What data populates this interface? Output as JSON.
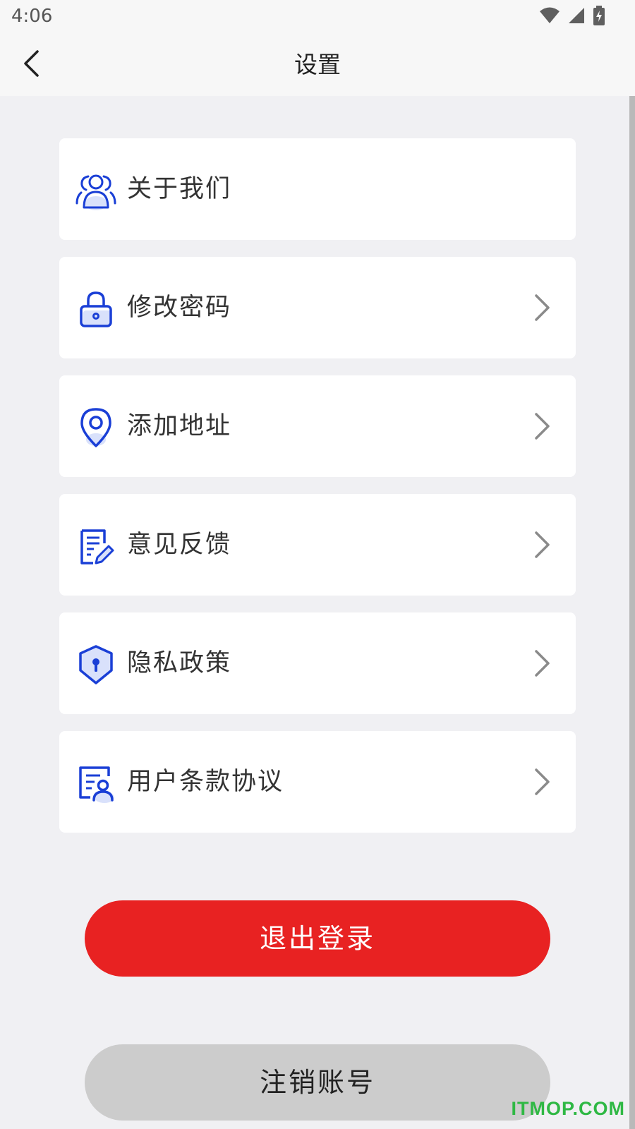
{
  "status_bar": {
    "time": "4:06",
    "icons": [
      "wifi-icon",
      "signal-icon",
      "battery-charging-icon"
    ]
  },
  "navbar": {
    "back_icon": "back-chevron-icon",
    "title": "设置"
  },
  "settings": {
    "items": [
      {
        "label": "关于我们",
        "icon": "users-icon",
        "has_chevron": false
      },
      {
        "label": "修改密码",
        "icon": "lock-icon",
        "has_chevron": true
      },
      {
        "label": "添加地址",
        "icon": "location-pin-icon",
        "has_chevron": true
      },
      {
        "label": "意见反馈",
        "icon": "feedback-edit-icon",
        "has_chevron": true
      },
      {
        "label": "隐私政策",
        "icon": "privacy-shield-icon",
        "has_chevron": true
      },
      {
        "label": "用户条款协议",
        "icon": "user-agreement-icon",
        "has_chevron": true
      }
    ]
  },
  "actions": {
    "logout_label": "退出登录",
    "cancel_account_label": "注销账号"
  },
  "watermark": "ITMOP.COM",
  "colors": {
    "icon_blue": "#1a3fd6",
    "icon_fill_light": "#d9e1fb",
    "logout_red": "#e82222",
    "cancel_gray": "#cccccc",
    "watermark_green": "#2fb844"
  }
}
